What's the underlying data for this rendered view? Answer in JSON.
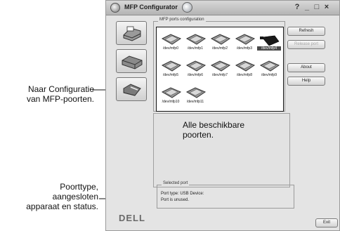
{
  "window": {
    "title": "MFP Configurator",
    "controls": [
      "?",
      "_",
      "□",
      "×"
    ]
  },
  "config_panel": {
    "group_label": "MFP ports configuration",
    "ports": [
      {
        "label": "/dev/mfp0",
        "selected": false
      },
      {
        "label": "/dev/mfp1",
        "selected": false
      },
      {
        "label": "/dev/mfp2",
        "selected": false
      },
      {
        "label": "/dev/mfp3",
        "selected": false
      },
      {
        "label": "/dev/mfp4",
        "selected": true
      },
      {
        "label": "/dev/mfp5",
        "selected": false
      },
      {
        "label": "/dev/mfp6",
        "selected": false
      },
      {
        "label": "/dev/mfp7",
        "selected": false
      },
      {
        "label": "/dev/mfp8",
        "selected": false
      },
      {
        "label": "/dev/mfp9",
        "selected": false
      },
      {
        "label": "/dev/mfp10",
        "selected": false
      },
      {
        "label": "/dev/mfp11",
        "selected": false
      }
    ]
  },
  "selected_port": {
    "group_label": "Selected port",
    "type_line": "Port type: USB   Device:",
    "status_line": "Port is unused."
  },
  "buttons": {
    "refresh": "Refresh",
    "release_port": "Release port",
    "about": "About",
    "help": "Help",
    "exit": "Exit"
  },
  "brand": "DELL",
  "callouts": {
    "left_top": [
      "Naar Configuratie",
      "van MFP-poorten."
    ],
    "bottom_center": [
      "Alle beschikbare",
      "poorten."
    ],
    "bottom_left": [
      "Poorttype,",
      "aangesloten",
      "apparaat en status."
    ]
  },
  "colors": {
    "window_bg": "#e4e4e4",
    "selection": "#4a4a4a"
  }
}
